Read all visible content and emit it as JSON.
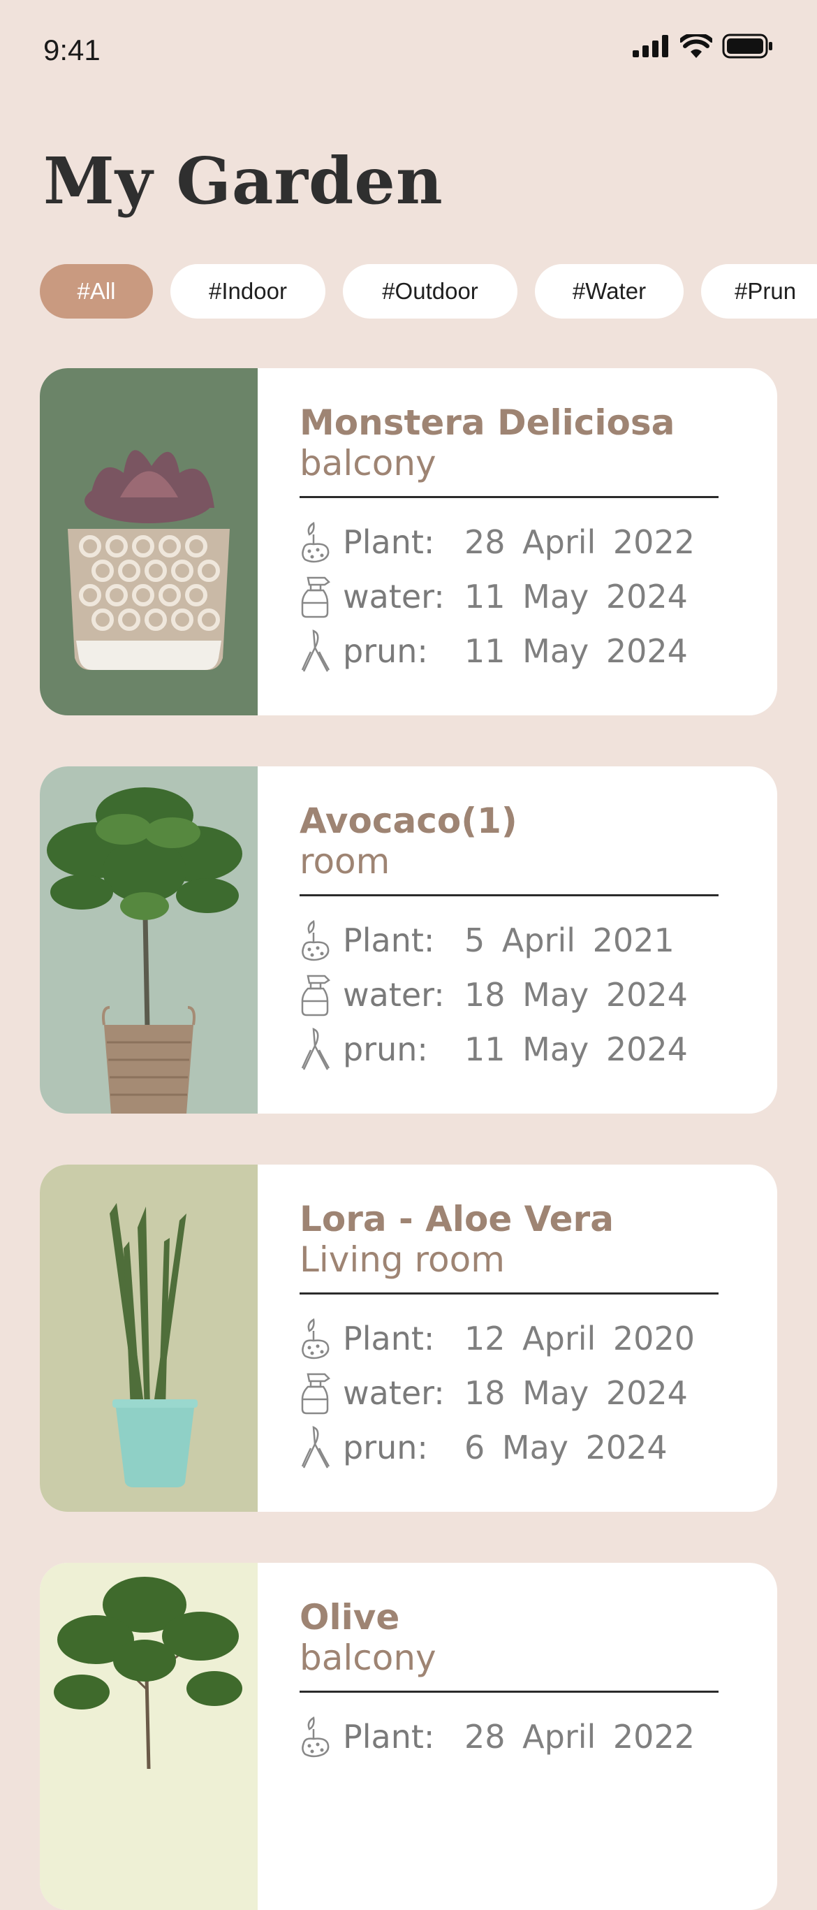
{
  "status_bar": {
    "time": "9:41"
  },
  "header": {
    "title": "My Garden"
  },
  "filters": [
    {
      "label": "#All",
      "active": true
    },
    {
      "label": "#Indoor",
      "active": false
    },
    {
      "label": "#Outdoor",
      "active": false
    },
    {
      "label": "#Water",
      "active": false
    },
    {
      "label": "#Prun",
      "active": false
    }
  ],
  "plants": [
    {
      "name": "Monstera Deliciosa",
      "location": "balcony",
      "image_bg": "#6b8468",
      "rows": [
        {
          "label": "Plant:",
          "value": "28 April 2022"
        },
        {
          "label": "water:",
          "value": "11 May 2024"
        },
        {
          "label": "prun:",
          "value": "11 May 2024"
        }
      ]
    },
    {
      "name": "Avocaco(1)",
      "location": "room",
      "image_bg": "#b1c4b6",
      "rows": [
        {
          "label": "Plant:",
          "value": "5 April 2021"
        },
        {
          "label": "water:",
          "value": "18 May 2024"
        },
        {
          "label": "prun:",
          "value": "11 May 2024"
        }
      ]
    },
    {
      "name": "Lora - Aloe Vera",
      "location": "Living room",
      "image_bg": "#cacca9",
      "rows": [
        {
          "label": "Plant:",
          "value": "12 April 2020"
        },
        {
          "label": "water:",
          "value": "18 May 2024"
        },
        {
          "label": "prun:",
          "value": "6 May 2024"
        }
      ]
    },
    {
      "name": "Olive",
      "location": "balcony",
      "image_bg": "#eef0d5",
      "rows": [
        {
          "label": "Plant:",
          "value": "28 April 2022"
        }
      ]
    }
  ],
  "icons": {
    "plant": "seedling-icon",
    "water": "spray-bottle-icon",
    "prun": "pruning-shears-icon"
  }
}
